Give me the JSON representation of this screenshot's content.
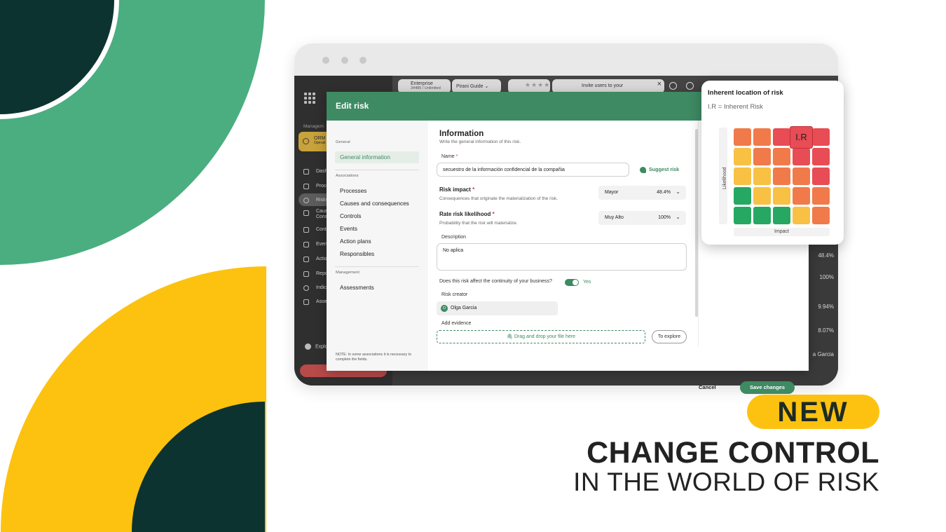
{
  "colors": {
    "brand_green": "#3d8a63",
    "dark_green": "#0d3330",
    "light_green": "#4bae80",
    "yellow": "#fcc20f",
    "heat_red": "#e84c55",
    "heat_orange": "#f17a4a",
    "heat_yellow": "#f8c143",
    "heat_green": "#27a862"
  },
  "app": {
    "sidebar": {
      "section_label": "Managem",
      "module": {
        "title": "ORM",
        "subtitle": "Operati"
      },
      "items": [
        {
          "label": "Dash",
          "icon": "monitor-icon"
        },
        {
          "label": "Proce",
          "icon": "process-icon"
        },
        {
          "label": "Risks",
          "icon": "alert-circle-icon"
        },
        {
          "label": "Caus",
          "label2": "Cons",
          "icon": "causes-icon"
        },
        {
          "label": "Cont",
          "icon": "controls-icon"
        },
        {
          "label": "Even",
          "icon": "warning-icon"
        },
        {
          "label": "Actio",
          "icon": "checkbox-icon"
        },
        {
          "label": "Repo",
          "icon": "report-icon"
        },
        {
          "label": "Indic",
          "icon": "target-icon"
        },
        {
          "label": "Asse",
          "icon": "assessment-icon"
        }
      ],
      "explore": "Explo"
    },
    "topbar": {
      "plan_title": "Enterprise",
      "plan_sub": "34485 / Unlimited",
      "guide": "Pirani Guide",
      "stars": "★★★★",
      "invite": "Invite users to your",
      "close": "×"
    },
    "background_values": [
      "48.4%",
      "100%",
      "9.94%",
      "8.07%",
      "a Garcia"
    ]
  },
  "modal": {
    "title": "Edit risk",
    "nav": {
      "sections": {
        "general": "General",
        "associations": "Associations",
        "management": "Management"
      },
      "general_items": [
        "General information"
      ],
      "association_items": [
        "Processes",
        "Causes and consequences",
        "Controls",
        "Events",
        "Action plans",
        "Responsibles"
      ],
      "management_items": [
        "Assessments"
      ],
      "note": "NOTE: In some associations it is necessary to complete the fields."
    },
    "form": {
      "section_title": "Information",
      "section_subtitle": "Write the general information of this risk.",
      "name_label": "Name",
      "required_mark": "*",
      "name_value": "secuestro de la información confidencial de la compañia",
      "suggest_label": "Suggest risk",
      "impact_label": "Risk impact",
      "impact_hint": "Consequences that originate the materialization of the risk.",
      "impact_value": "Mayor",
      "impact_percent": "48.4%",
      "likelihood_label": "Rate risk likelihood",
      "likelihood_hint": "Probability that the risk will materialize.",
      "likelihood_value": "Muy Alto",
      "likelihood_percent": "100%",
      "description_label": "Description",
      "description_value": "No aplica",
      "continuity_question": "Does this risk affect the continuity of your business?",
      "continuity_value": "Yes",
      "creator_label": "Risk creator",
      "creator_initial": "O",
      "creator_name": "Olga Garcia",
      "evidence_label": "Add evidence",
      "dropzone_text": "Drag and drop your file here",
      "explore_button": "To explore"
    },
    "footer": {
      "cancel": "Cancel",
      "save": "Save changes"
    }
  },
  "popover": {
    "title": "Inherent location of risk",
    "subtitle": "I.R = Inherent Risk",
    "y_label": "Likelihood",
    "x_label": "Impact",
    "marker_label": "I.R",
    "marker_row": 0,
    "marker_col": 3,
    "grid": [
      [
        "orange",
        "orange",
        "red",
        "red",
        "red"
      ],
      [
        "yellow",
        "orange",
        "orange",
        "red",
        "red"
      ],
      [
        "yellow",
        "yellow",
        "orange",
        "orange",
        "red"
      ],
      [
        "green",
        "yellow",
        "yellow",
        "orange",
        "orange"
      ],
      [
        "green",
        "green",
        "green",
        "yellow",
        "orange"
      ]
    ]
  },
  "banner": {
    "badge": "NEW",
    "headline": "CHANGE CONTROL",
    "subline": "IN THE WORLD OF RISK"
  }
}
